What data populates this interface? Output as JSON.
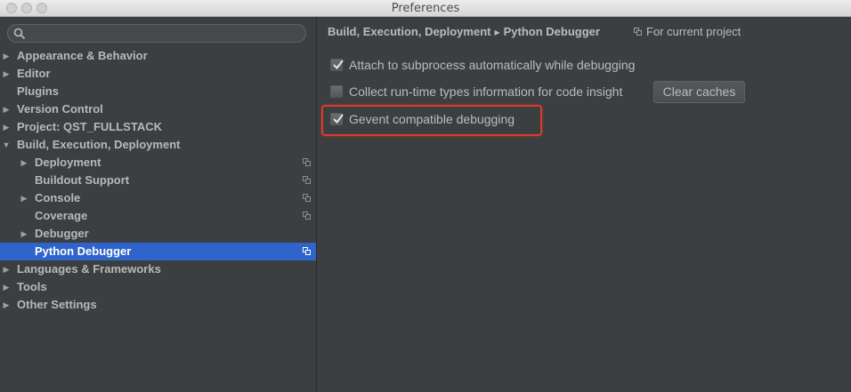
{
  "window": {
    "title": "Preferences"
  },
  "colors": {
    "selection": "#2f65ca",
    "highlight_border": "#e03a28"
  },
  "search": {
    "placeholder": "",
    "icon": "search-icon"
  },
  "tree": [
    {
      "label": "Appearance & Behavior",
      "expandable": true,
      "expanded": false,
      "level": 0
    },
    {
      "label": "Editor",
      "expandable": true,
      "expanded": false,
      "level": 0
    },
    {
      "label": "Plugins",
      "expandable": false,
      "level": 0
    },
    {
      "label": "Version Control",
      "expandable": true,
      "expanded": false,
      "level": 0
    },
    {
      "label": "Project: QST_FULLSTACK",
      "expandable": true,
      "expanded": false,
      "level": 0
    },
    {
      "label": "Build, Execution, Deployment",
      "expandable": true,
      "expanded": true,
      "level": 0
    },
    {
      "label": "Deployment",
      "expandable": true,
      "expanded": false,
      "level": 1,
      "project_icon": true
    },
    {
      "label": "Buildout Support",
      "expandable": false,
      "level": 1,
      "project_icon": true
    },
    {
      "label": "Console",
      "expandable": true,
      "expanded": false,
      "level": 1,
      "project_icon": true
    },
    {
      "label": "Coverage",
      "expandable": false,
      "level": 1,
      "project_icon": true
    },
    {
      "label": "Debugger",
      "expandable": true,
      "expanded": false,
      "level": 1
    },
    {
      "label": "Python Debugger",
      "expandable": false,
      "level": 1,
      "project_icon": true,
      "selected": true
    },
    {
      "label": "Languages & Frameworks",
      "expandable": true,
      "expanded": false,
      "level": 0
    },
    {
      "label": "Tools",
      "expandable": true,
      "expanded": false,
      "level": 0
    },
    {
      "label": "Other Settings",
      "expandable": true,
      "expanded": false,
      "level": 0
    }
  ],
  "breadcrumb": {
    "parent": "Build, Execution, Deployment",
    "current": "Python Debugger"
  },
  "scope": {
    "label": "For current project",
    "icon": "project-scope-icon"
  },
  "options": [
    {
      "label": "Attach to subprocess automatically while debugging",
      "checked": true
    },
    {
      "label": "Collect run-time types information for code insight",
      "checked": false
    },
    {
      "label": "Gevent compatible debugging",
      "checked": true
    }
  ],
  "buttons": {
    "clear_caches": "Clear caches"
  }
}
